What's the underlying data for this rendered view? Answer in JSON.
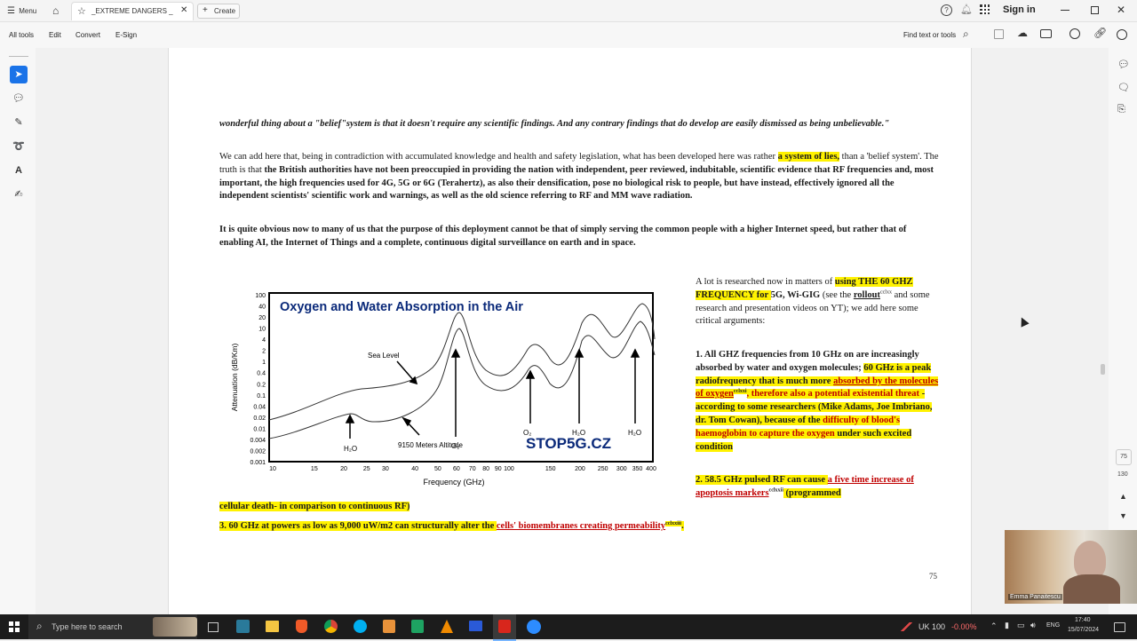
{
  "titlebar": {
    "menu_label": "Menu",
    "tab_title": "_EXTREME DANGERS _",
    "create_label": "Create",
    "sign_in": "Sign in"
  },
  "toolbar": {
    "items": [
      "All tools",
      "Edit",
      "Convert",
      "E-Sign"
    ],
    "find_label": "Find text or tools"
  },
  "document": {
    "p1": "wonderful thing about a \"belief\"system is that it doesn't require any scientific findings. And any contrary findings that do develop are easily dismissed as being unbelievable.\"",
    "p2_a": "We can add here that, being in contradiction with accumulated knowledge and health and safety legislation, what has been developed here was rather ",
    "p2_hl": "a system of lies,",
    "p2_b": " than a 'belief system'. The  truth is that ",
    "p2_bold": "the British authorities have not been preoccupied in providing the nation with independent, peer reviewed, indubitable, scientific evidence that RF frequencies and, most important, the high frequencies used for 4G, 5G or 6G (Terahertz), as also their densification, pose no biological risk to people, but have instead, effectively ignored all the independent scientists' scientific work and warnings, as well as the old science referring to RF and MM wave radiation.",
    "p3": "It is quite obvious now to many of us that the purpose of this deployment cannot be that of simply serving the common people with a higher Internet speed, but rather that of enabling AI, the Internet of Things and a complete, continuous digital surveillance on earth and in space.",
    "side_a1": "A lot is researched now in matters of ",
    "side_a_hl": "using THE 60 GHZ FREQUENCY for ",
    "side_a2": "5G, Wi-GIG",
    "side_a3": " (see the ",
    "side_a_link": "rollout",
    "side_a_sup": "cclxx",
    "side_a4": " and some research and presentation videos on YT); we add here some critical arguments:",
    "side_b1": "1. All GHZ frequencies from 10 GHz on are increasingly absorbed by water and oxygen molecules; ",
    "side_b_hl": "60 GHz is a peak radiofrequency that is much more ",
    "side_b_link": "absorbed by the molecules of oxygen",
    "side_b_sup": "cclxxi",
    "side_b_red": ", therefore also a potential existential threat",
    "side_b2": " - according to some researchers (",
    "side_b_names": "Mike Adams, Joe Imbriano, dr. Tom Cowan",
    "side_b3": "), because of the ",
    "side_b_red2": "difficulty of blood's haemoglobin to capture the oxygen",
    "side_b4": " under such excited condition",
    "side_c_hl": "2. 58.5 GHz pulsed RF can cause ",
    "side_c_link": "a five time increase of apoptosis markers",
    "side_c_sup": "cclxxii",
    "side_c_end": " (programmed",
    "full_c": "cellular death- in comparison to continuous RF)",
    "p4_hl": "3. 60 GHz at powers as low as 9,000 uW/m2 can structurally  alter the ",
    "p4_link": "cells' biomembranes creating permeability",
    "p4_sup": "cclxxiii",
    "p4_end": ".",
    "page_number": "75"
  },
  "figure": {
    "title": "Oxygen and Water Absorption in the Air",
    "watermark": "STOP5G.CZ",
    "ylabel": "Attenuation (dB/Km)",
    "xlabel": "Frequency (GHz)",
    "y_ticks": [
      "100",
      "40",
      "20",
      "10",
      "4",
      "2",
      "1",
      "0.4",
      "0.2",
      "0.1",
      "0.04",
      "0.02",
      "0.01",
      "0.004",
      "0.002",
      "0.001"
    ],
    "x_ticks": [
      "10",
      "15",
      "20",
      "25",
      "30",
      "40",
      "50",
      "60",
      "70",
      "80",
      "90",
      "100",
      "150",
      "200",
      "250",
      "300",
      "350",
      "400"
    ],
    "annotations": {
      "sea_level": "Sea Level",
      "altitude": "9150 Meters Altitude",
      "h2o_1": "H₂O",
      "o2_1": "O₂",
      "o2_2": "O₂",
      "h2o_2": "H₂O",
      "h2o_3": "H₂O"
    }
  },
  "webcam": {
    "name": "Emma Panaitescu"
  },
  "taskbar": {
    "search_placeholder": "Type here to search",
    "weather": "UK 100",
    "change": "-0.00%",
    "lang": "ENG",
    "time": "17:40",
    "date": "15/07/2024"
  }
}
